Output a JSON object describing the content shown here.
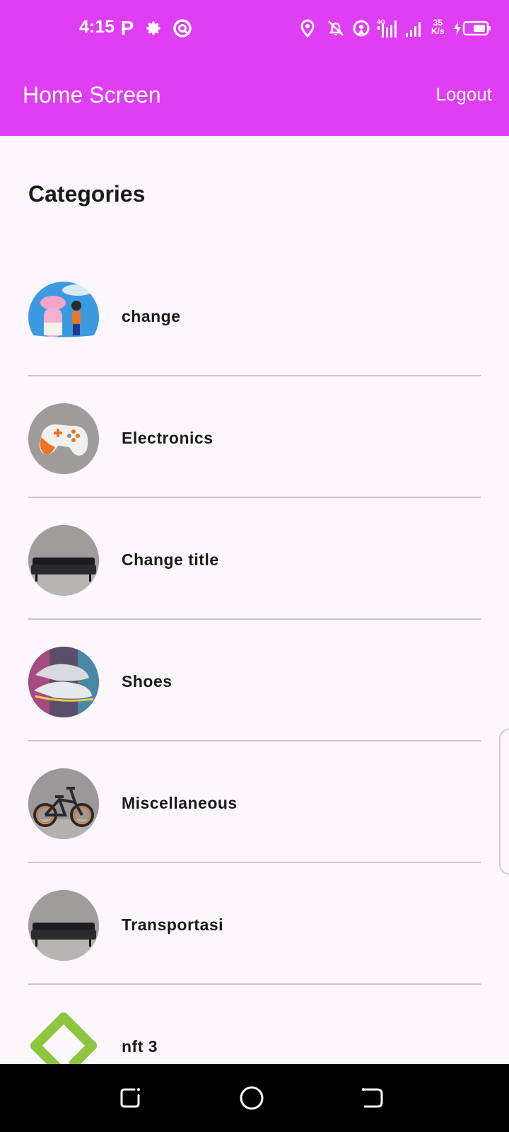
{
  "status_bar": {
    "time": "4:15",
    "speed_value": "35",
    "speed_unit": "K/s",
    "network_type": "4G"
  },
  "app_bar": {
    "title": "Home Screen",
    "logout_label": "Logout",
    "color": "#e03ef5"
  },
  "main": {
    "section_title": "Categories",
    "categories": [
      {
        "label": "change",
        "image": "anime-characters-thumbnail"
      },
      {
        "label": "Electronics",
        "image": "game-controller-thumbnail"
      },
      {
        "label": "Change title",
        "image": "sofa-thumbnail"
      },
      {
        "label": "Shoes",
        "image": "sneakers-thumbnail"
      },
      {
        "label": "Miscellaneous",
        "image": "bicycle-thumbnail"
      },
      {
        "label": "Transportasi",
        "image": "sofa-thumbnail"
      },
      {
        "label": "nft 3",
        "image": "green-logo-thumbnail"
      }
    ]
  },
  "nav_bar": {
    "buttons": [
      "recent-apps",
      "home",
      "back"
    ]
  }
}
